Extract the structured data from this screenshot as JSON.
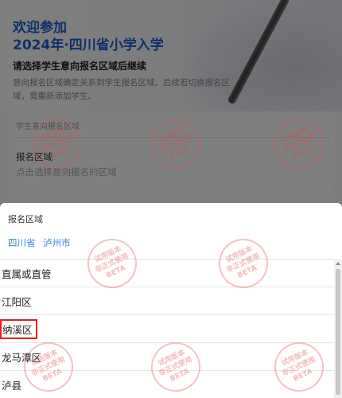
{
  "background_page": {
    "welcome": "欢迎参加",
    "title": "2024年·四川省小学入学",
    "subtitle": "请选择学生意向报名区域后继续",
    "description": "意向报名区域确定关系到学生报名区域。后续若切换报名区域，需重新添加学生。",
    "student_area_hint": "学生意向报名区域",
    "field_label": "报名区域",
    "field_placeholder": "点击选择意向报名的区域"
  },
  "picker": {
    "title": "报名区域",
    "breadcrumbs": [
      "四川省",
      "泸州市"
    ],
    "options": [
      "直属或直管",
      "江阳区",
      "纳溪区",
      "龙马潭区",
      "泸县"
    ],
    "highlighted_option": "纳溪区"
  },
  "watermark": {
    "lines": [
      "试用版本",
      "非正式使用",
      "BETA"
    ]
  },
  "colors": {
    "brand_blue": "#1d5fd6",
    "link_blue": "#3a86d6",
    "highlight_red": "#e0231d"
  }
}
